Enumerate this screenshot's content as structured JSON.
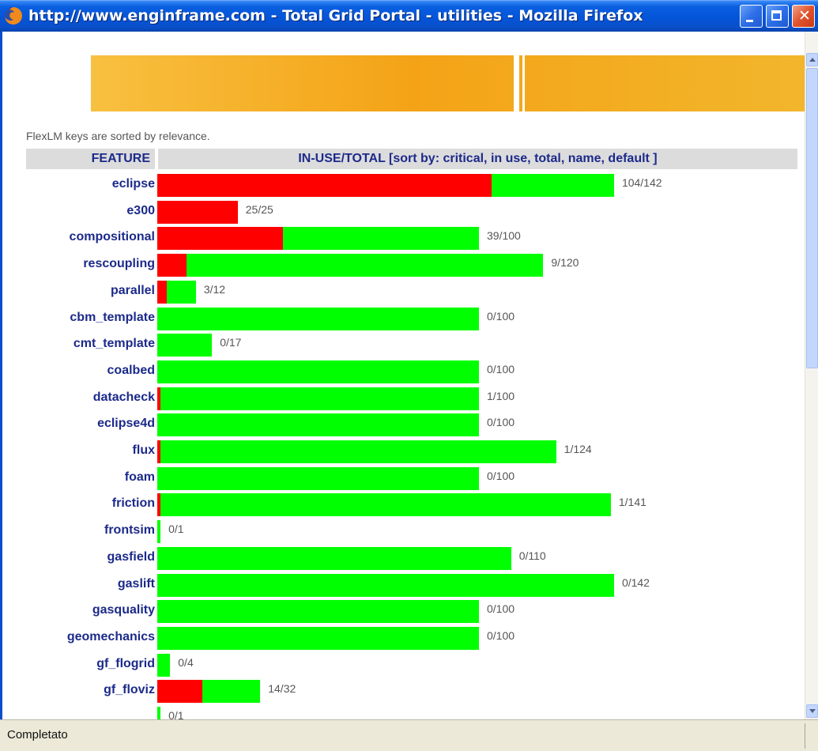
{
  "window": {
    "title": "http://www.enginframe.com - Total Grid Portal - utilities - Mozilla Firefox"
  },
  "page": {
    "info_text": "FlexLM keys are sorted by relevance.",
    "table": {
      "col_feature": "FEATURE",
      "col_inuse": "IN-USE/TOTAL [sort by: critical,  in use,  total,  name,  default ]"
    },
    "rows": [
      {
        "name": "eclipse",
        "in_use": 104,
        "total": 142,
        "count": "104/142"
      },
      {
        "name": "e300",
        "in_use": 25,
        "total": 25,
        "count": "25/25"
      },
      {
        "name": "compositional",
        "in_use": 39,
        "total": 100,
        "count": "39/100"
      },
      {
        "name": "rescoupling",
        "in_use": 9,
        "total": 120,
        "count": "9/120"
      },
      {
        "name": "parallel",
        "in_use": 3,
        "total": 12,
        "count": "3/12"
      },
      {
        "name": "cbm_template",
        "in_use": 0,
        "total": 100,
        "count": "0/100"
      },
      {
        "name": "cmt_template",
        "in_use": 0,
        "total": 17,
        "count": "0/17"
      },
      {
        "name": "coalbed",
        "in_use": 0,
        "total": 100,
        "count": "0/100"
      },
      {
        "name": "datacheck",
        "in_use": 1,
        "total": 100,
        "count": "1/100"
      },
      {
        "name": "eclipse4d",
        "in_use": 0,
        "total": 100,
        "count": "0/100"
      },
      {
        "name": "flux",
        "in_use": 1,
        "total": 124,
        "count": "1/124"
      },
      {
        "name": "foam",
        "in_use": 0,
        "total": 100,
        "count": "0/100"
      },
      {
        "name": "friction",
        "in_use": 1,
        "total": 141,
        "count": "1/141"
      },
      {
        "name": "frontsim",
        "in_use": 0,
        "total": 1,
        "count": "0/1"
      },
      {
        "name": "gasfield",
        "in_use": 0,
        "total": 110,
        "count": "0/110"
      },
      {
        "name": "gaslift",
        "in_use": 0,
        "total": 142,
        "count": "0/142"
      },
      {
        "name": "gasquality",
        "in_use": 0,
        "total": 100,
        "count": "0/100"
      },
      {
        "name": "geomechanics",
        "in_use": 0,
        "total": 100,
        "count": "0/100"
      },
      {
        "name": "gf_flogrid",
        "in_use": 0,
        "total": 4,
        "count": "0/4"
      },
      {
        "name": "gf_floviz",
        "in_use": 14,
        "total": 32,
        "count": "14/32"
      },
      {
        "name": "",
        "in_use": 0,
        "total": 1,
        "count": "0/1"
      }
    ]
  },
  "statusbar": {
    "text": "Completato"
  },
  "colors": {
    "in_use": "#ff0000",
    "free": "#00ff00",
    "label": "#1c2a8a",
    "banner": "#f4a316"
  }
}
